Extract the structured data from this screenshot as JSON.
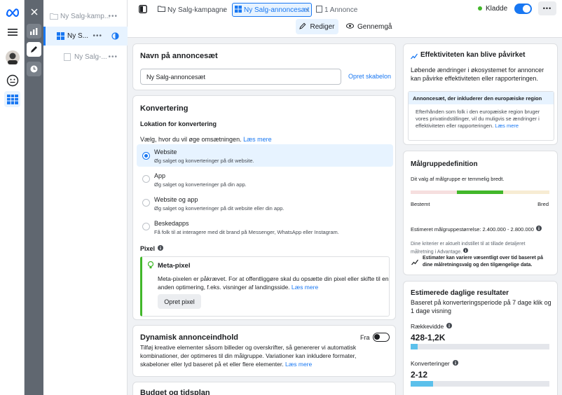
{
  "colors": {
    "accent": "#1877f2",
    "status_green": "#42b72a"
  },
  "tree": {
    "campaign": "Ny Salg-kamp...",
    "adset": "Ny S...",
    "ad": "Ny Salg-..."
  },
  "breadcrumbs": {
    "campaign": "Ny Salg-kampagne",
    "adset": "Ny Salg-annoncesæt",
    "ad": "1 Annonce"
  },
  "status": {
    "label": "Kladde"
  },
  "modes": {
    "edit": "Rediger",
    "review": "Gennemgå"
  },
  "name_card": {
    "title": "Navn på annoncesæt",
    "value": "Ny Salg-annoncesæt",
    "template_link": "Opret skabelon"
  },
  "conversion": {
    "title": "Konvertering",
    "location_title": "Lokation for konvertering",
    "prompt": "Vælg, hvor du vil øge omsætningen.",
    "learn_more": "Læs mere",
    "options": [
      {
        "title": "Website",
        "desc": "Øg salget og konverteringer på dit website."
      },
      {
        "title": "App",
        "desc": "Øg salget og konverteringer på din app."
      },
      {
        "title": "Website og app",
        "desc": "Øg salget og konverteringer på dit website eller din app."
      },
      {
        "title": "Beskedapps",
        "desc": "Få folk til at interagere med dit brand på Messenger, WhatsApp eller Instagram."
      }
    ],
    "pixel_label": "Pixel",
    "pixel_box": {
      "title": "Meta-pixel",
      "text": "Meta-pixelen er påkrævet. For at offentliggøre skal du opsætte din pixel eller skifte til en anden optimering, f.eks. visninger af landingsside.",
      "learn_more": "Læs mere",
      "button": "Opret pixel"
    }
  },
  "dynamic": {
    "title": "Dynamisk annonceindhold",
    "toggle_label": "Fra",
    "text": "Tilføj kreative elementer såsom billeder og overskrifter, så genererer vi automatisk kombinationer, der optimeres til din målgruppe. Variationer kan inkludere formater, skabeloner eller lyd baseret på et eller flere elementer.",
    "learn_more": "Læs mere"
  },
  "budget": {
    "title": "Budget og tidsplan"
  },
  "efficiency": {
    "title": "Effektiviteten kan blive påvirket",
    "text": "Løbende ændringer i økosystemet for annoncer kan påvirke effektiviteten eller rapporteringen.",
    "sub_title": "Annoncesæt, der inkluderer den europæiske region",
    "sub_text": "Efterhånden som folk i den europæiske region bruger vores privatindstillinger, vil du muligvis se ændringer i effektiviteten eller rapporteringen.",
    "learn_more": "Læs mere"
  },
  "audience": {
    "title": "Målgruppedefinition",
    "subtitle": "Dit valg af målgruppe er temmelig bredt.",
    "specific": "Bestemt",
    "broad": "Bred",
    "estimate": "Estimeret målgruppestørrelse: 2.400.000 - 2.800.000",
    "criteria": "Dine kriterier er aktuelt indstillet til at tillade detaljeret målretning i Advantage.",
    "note": "Estimater kan variere væsentligt over tid baseret på dine målretningsvalg og den tilgængelige data."
  },
  "daily": {
    "title": "Estimerede daglige resultater",
    "subtitle": "Baseret på konverteringsperiode på 7 dage klik og 1 dage visning",
    "reach_label": "Rækkevidde",
    "reach_value": "428-1,2K",
    "reach_fraction": 0.05,
    "conv_label": "Konverteringer",
    "conv_value": "2-12",
    "conv_fraction": 0.16
  }
}
